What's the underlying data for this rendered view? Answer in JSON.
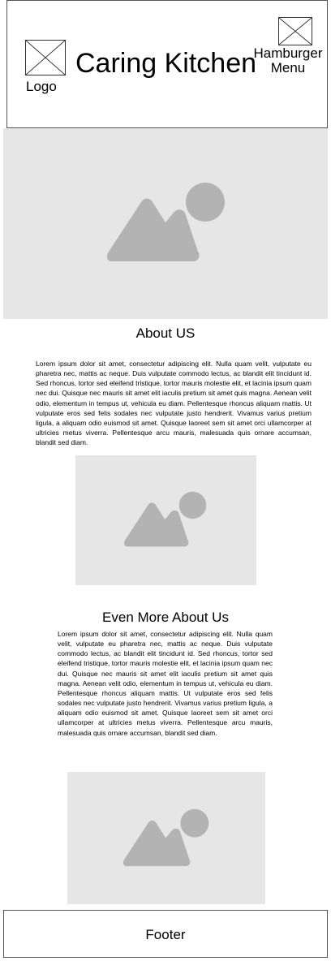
{
  "header": {
    "logo_label": "Logo",
    "title": "Caring Kitchen",
    "menu_label_line1": "Hamburger",
    "menu_label_line2": "Menu"
  },
  "sections": [
    {
      "title": "About US",
      "body": "Lorem ipsum dolor sit amet, consectetur adipiscing elit. Nulla quam velit, vulputate eu pharetra nec, mattis ac neque. Duis vulputate commodo lectus, ac blandit elit tincidunt id. Sed rhoncus, tortor sed eleifend tristique, tortor mauris molestie elit, et lacinia ipsum quam nec dui. Quisque nec mauris sit amet elit iaculis pretium sit amet quis magna. Aenean velit odio, elementum in tempus ut, vehicula eu diam. Pellentesque rhoncus aliquam mattis. Ut vulputate eros sed felis sodales nec vulputate justo hendrerit. Vivamus varius pretium ligula, a aliquam odio euismod sit amet. Quisque laoreet sem sit amet orci ullamcorper at ultricies metus viverra. Pellentesque arcu mauris, malesuada quis ornare accumsan, blandit sed diam."
    },
    {
      "title": "Even More About Us",
      "body": "Lorem ipsum dolor sit amet, consectetur adipiscing elit. Nulla quam velit, vulputate eu pharetra nec, mattis ac neque. Duis vulputate commodo lectus, ac blandit elit tincidunt id. Sed rhoncus, tortor sed eleifend tristique, tortor mauris molestie elit, et lacinia ipsum quam nec dui. Quisque nec mauris sit amet elit iaculis pretium sit amet quis magna. Aenean velit odio, elementum in tempus ut, vehicula eu diam. Pellentesque rhoncus aliquam mattis. Ut vulputate eros sed felis sodales nec vulputate justo hendrerit. Vivamus varius pretium ligula, a aliquam odio euismod sit amet. Quisque laoreet sem sit amet orci ullamcorper at ultricies metus viverra. Pellentesque arcu mauris, malesuada quis ornare accumsan, blandit sed diam."
    }
  ],
  "footer": {
    "label": "Footer"
  },
  "colors": {
    "placeholder_bg": "#e6e6e6",
    "placeholder_icon": "#b3b3b3",
    "border": "#555555"
  },
  "icons": {
    "logo": "image-placeholder-x-icon",
    "menu": "hamburger-placeholder-x-icon",
    "images": "image-placeholder-icon"
  }
}
